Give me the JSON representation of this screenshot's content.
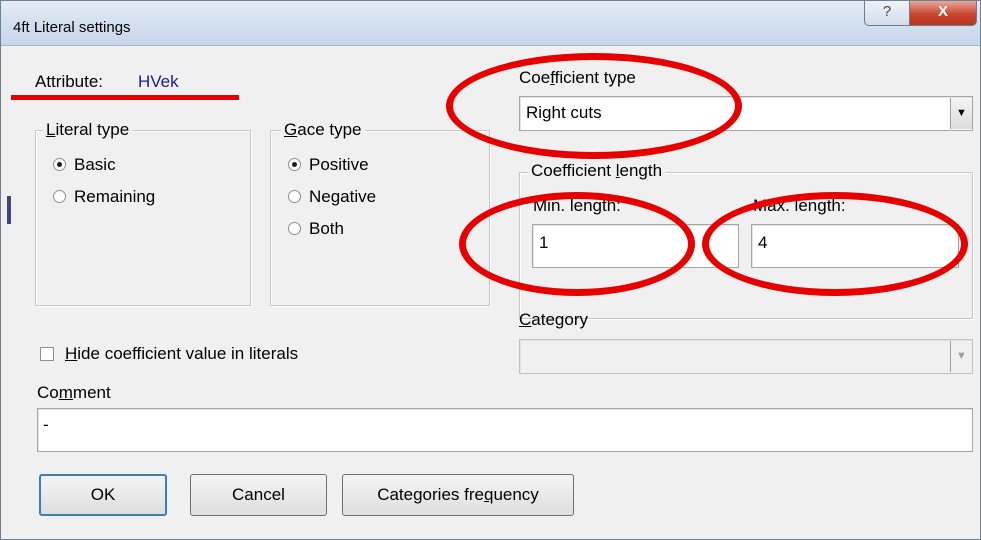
{
  "window": {
    "title": "4ft Literal settings",
    "help_button": "?",
    "close_button": "X"
  },
  "attribute": {
    "label": "Attribute:",
    "value": "HVek"
  },
  "literal_type": {
    "title_mnemonic": "L",
    "title_rest": "iteral type",
    "options": [
      {
        "label": "Basic",
        "selected": true
      },
      {
        "label": "Remaining",
        "selected": false
      }
    ]
  },
  "gace_type": {
    "title_mnemonic": "G",
    "title_rest": "ace type",
    "options": [
      {
        "label": "Positive",
        "selected": true
      },
      {
        "label": "Negative",
        "selected": false
      },
      {
        "label": "Both",
        "selected": false
      }
    ]
  },
  "coefficient_type": {
    "label_pre": "Coe",
    "label_mnemonic": "f",
    "label_post": "ficient type",
    "selected": "Right cuts"
  },
  "coefficient_length": {
    "title_pre": "Coefficient ",
    "title_mnemonic": "l",
    "title_post": "ength",
    "min_label": "Min. length:",
    "min_value": "1",
    "max_label": "Max. length:",
    "max_value": "4"
  },
  "category": {
    "label_mnemonic": "C",
    "label_rest": "ategory",
    "selected": ""
  },
  "hide_coefficient": {
    "label_mnemonic": "H",
    "label_rest": "ide coefficient value in literals",
    "checked": false
  },
  "comment": {
    "label_pre": "Co",
    "label_mnemonic": "m",
    "label_post": "ment",
    "value": "-"
  },
  "buttons": {
    "ok": "OK",
    "cancel": "Cancel",
    "categories_pre": "Categories fre",
    "categories_mnemonic": "q",
    "categories_post": "uency"
  },
  "annotation_color": "#e60000"
}
